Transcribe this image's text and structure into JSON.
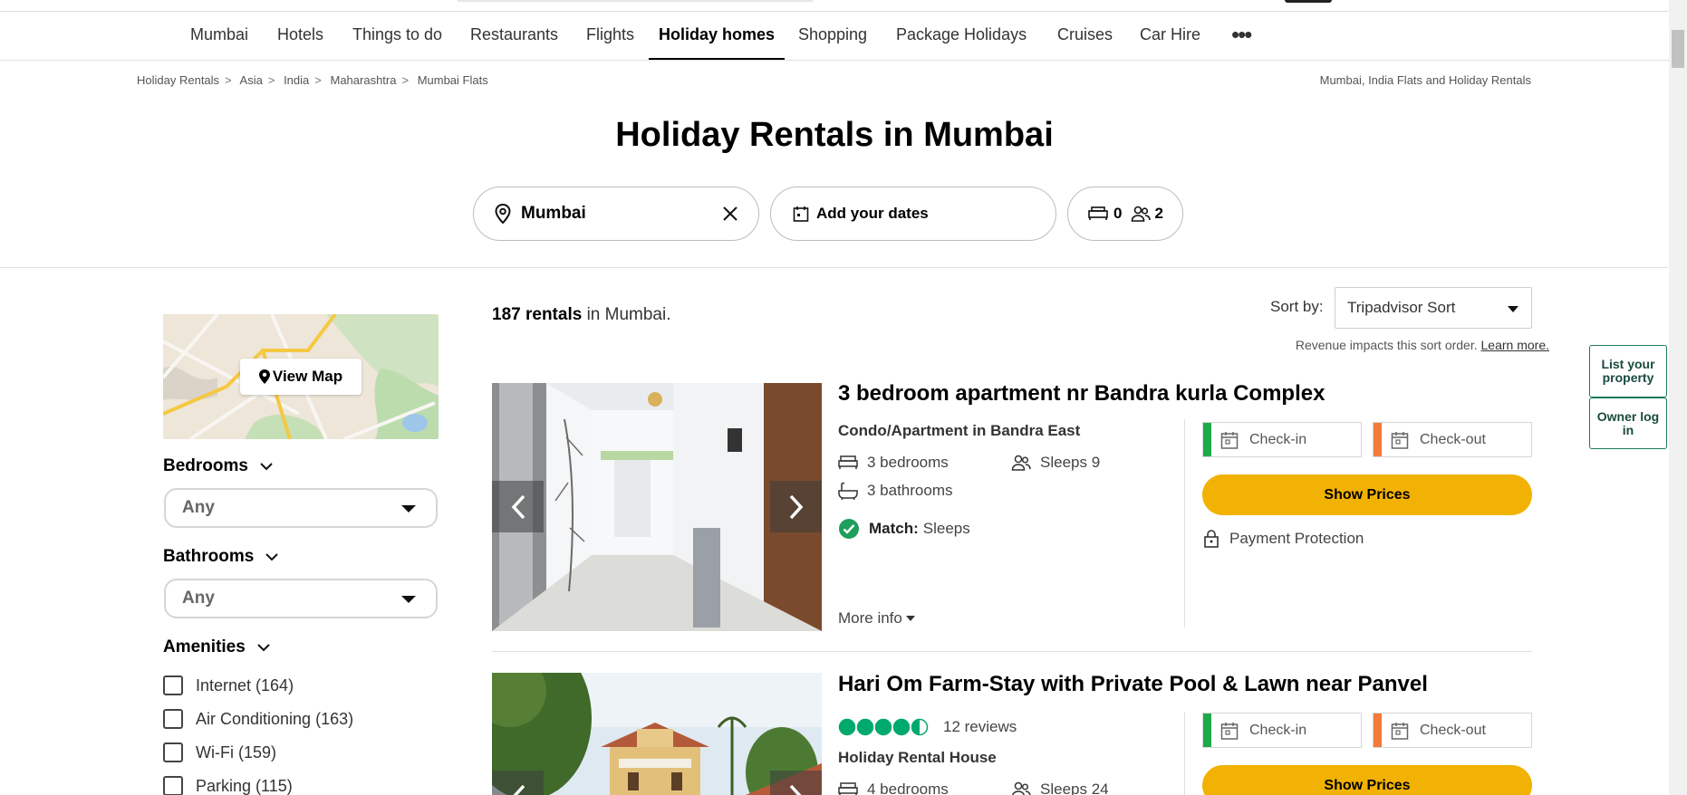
{
  "nav": {
    "items": [
      "Mumbai",
      "Hotels",
      "Things to do",
      "Restaurants",
      "Flights",
      "Holiday homes",
      "Shopping",
      "Package Holidays",
      "Cruises",
      "Car Hire"
    ],
    "more_label": "•••"
  },
  "breadcrumb": {
    "items": [
      "Holiday Rentals",
      "Asia",
      "India",
      "Maharashtra",
      "Mumbai Flats"
    ],
    "right_text": "Mumbai, India Flats and Holiday Rentals"
  },
  "page_title": "Holiday Rentals in Mumbai",
  "search": {
    "location_value": "Mumbai",
    "dates_label": "Add your dates",
    "bedrooms": "0",
    "guests": "2"
  },
  "filters": {
    "view_map_label": "View Map",
    "bedrooms_label": "Bedrooms",
    "bedrooms_value": "Any",
    "bathrooms_label": "Bathrooms",
    "bathrooms_value": "Any",
    "amenities_label": "Amenities",
    "amenities": [
      "Internet (164)",
      "Air Conditioning (163)",
      "Wi-Fi (159)",
      "Parking (115)"
    ]
  },
  "results": {
    "count_bold": "187 rentals",
    "count_rest": " in Mumbai.",
    "sort_label": "Sort by:",
    "sort_value": "Tripadvisor Sort",
    "sort_note": "Revenue impacts this sort order.",
    "sort_note_link": "Learn more."
  },
  "listings": [
    {
      "title": "3 bedroom apartment nr Bandra kurla Complex",
      "type": "Condo/Apartment in Bandra East",
      "bedrooms": "3 bedrooms",
      "bathrooms": "3 bathrooms",
      "sleeps": "Sleeps 9",
      "match_label": "Match:",
      "match_value": "Sleeps",
      "more_info": "More info",
      "checkin": "Check-in",
      "checkout": "Check-out",
      "show_prices": "Show Prices",
      "payment_protection": "Payment Protection"
    },
    {
      "title": "Hari Om Farm-Stay with Private Pool & Lawn near Panvel",
      "rating": 4.5,
      "reviews": "12 reviews",
      "type": "Holiday Rental House",
      "bedrooms": "4 bedrooms",
      "sleeps": "Sleeps 24",
      "checkin": "Check-in",
      "checkout": "Check-out",
      "show_prices": "Show Prices"
    }
  ],
  "side": {
    "list_property": "List your property",
    "owner_login": "Owner log in"
  },
  "colors": {
    "accent_yellow": "#f2b203",
    "tripadvisor_green": "#00aa6c",
    "checkin_bar": "#1faa4a",
    "checkout_bar": "#f5793a"
  }
}
